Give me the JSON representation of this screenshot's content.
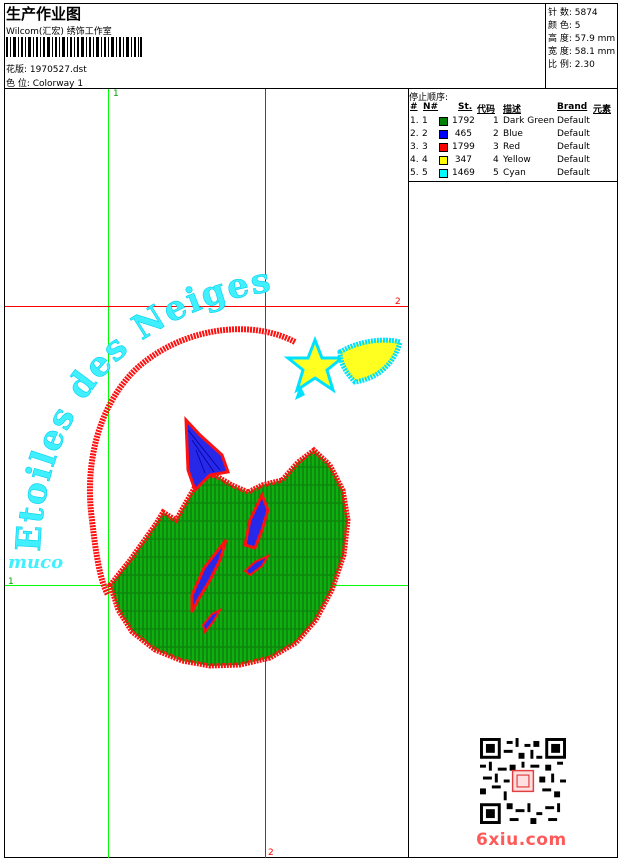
{
  "header": {
    "title": "生产作业图",
    "studio": "Wilcom(汇宏) 绣饰工作室",
    "pattern": "花版: 1970527.dst",
    "colorway": "色 位:  Colorway 1"
  },
  "stats": [
    "针 数: 5874",
    "颜 色: 5",
    "高 度: 57.9 mm",
    "宽 度: 58.1 mm",
    "比 例: 2.30"
  ],
  "stop_sequence": {
    "title": "停止顺序:",
    "headers": [
      "#",
      "N#",
      "St.",
      "代码",
      "描述",
      "Brand",
      "元素"
    ],
    "rows": [
      {
        "num": "1.",
        "n": "1",
        "color": "#008000",
        "stitches": "1792",
        "code": "1",
        "desc": "Dark Green",
        "brand": "Default"
      },
      {
        "num": "2.",
        "n": "2",
        "color": "#0000ff",
        "stitches": "465",
        "code": "2",
        "desc": "Blue",
        "brand": "Default"
      },
      {
        "num": "3.",
        "n": "3",
        "color": "#ff0000",
        "stitches": "1799",
        "code": "3",
        "desc": "Red",
        "brand": "Default"
      },
      {
        "num": "4.",
        "n": "4",
        "color": "#ffff00",
        "stitches": "347",
        "code": "4",
        "desc": "Yellow",
        "brand": "Default"
      },
      {
        "num": "5.",
        "n": "5",
        "color": "#00ffff",
        "stitches": "1469",
        "code": "5",
        "desc": "Cyan",
        "brand": "Default"
      }
    ]
  },
  "guides": {
    "v1": "1",
    "h1": "1",
    "h2": "2",
    "v2": "2"
  },
  "design": {
    "arc_text": "Etoiles des Neiges",
    "small_text": "muco"
  },
  "watermark": {
    "site": "6xiu.com"
  },
  "colors": {
    "guide_green": "#00ff00",
    "guide_red": "#ff0000"
  }
}
